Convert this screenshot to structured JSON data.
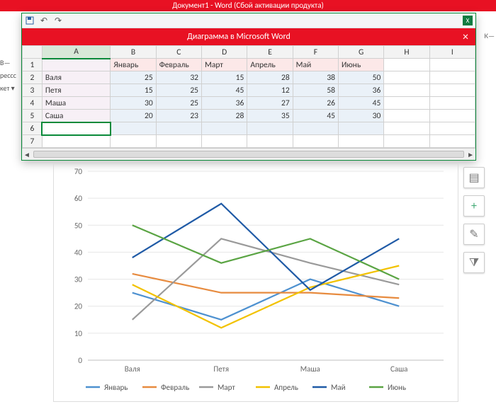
{
  "word_title": "Документ1 - Word (Сбой активации продукта)",
  "excel_title": "Диаграмма в Microsoft Word",
  "left_sliver": [
    "B—",
    "рессс",
    "кет ▾"
  ],
  "right_cut": "К—",
  "col_headers": [
    "A",
    "B",
    "C",
    "D",
    "E",
    "F",
    "G",
    "H",
    "I"
  ],
  "row_numbers": [
    "1",
    "2",
    "3",
    "4",
    "5",
    "6",
    "7"
  ],
  "series_headers": [
    "Январь",
    "Февраль",
    "Март",
    "Апрель",
    "Май",
    "Июнь"
  ],
  "row_labels": [
    "Валя",
    "Петя",
    "Маша",
    "Саша"
  ],
  "grid": [
    [
      25,
      32,
      15,
      28,
      38,
      50
    ],
    [
      15,
      25,
      45,
      12,
      58,
      36
    ],
    [
      30,
      25,
      36,
      27,
      26,
      45
    ],
    [
      20,
      23,
      28,
      35,
      45,
      30
    ]
  ],
  "scroll_markers": {
    "left": "◄",
    "right": "►"
  },
  "side_buttons": [
    {
      "name": "chart-layout-icon",
      "glyph": "▤"
    },
    {
      "name": "chart-element-add-icon",
      "glyph": "+"
    },
    {
      "name": "chart-style-icon",
      "glyph": "✎"
    },
    {
      "name": "chart-filter-icon",
      "glyph": "⧩"
    }
  ],
  "colors": {
    "Январь": "#4e91d0",
    "Февраль": "#e78b3f",
    "Март": "#9a9a9a",
    "Апрель": "#f2c200",
    "Май": "#1f5aa6",
    "Июнь": "#5aa443",
    "grid": "#e6e6e6",
    "axis": "#bfbfbf"
  },
  "chart_data": {
    "type": "line",
    "categories": [
      "Валя",
      "Петя",
      "Маша",
      "Саша"
    ],
    "series": [
      {
        "name": "Январь",
        "values": [
          25,
          15,
          30,
          20
        ]
      },
      {
        "name": "Февраль",
        "values": [
          32,
          25,
          25,
          23
        ]
      },
      {
        "name": "Март",
        "values": [
          15,
          45,
          36,
          28
        ]
      },
      {
        "name": "Апрель",
        "values": [
          28,
          12,
          27,
          35
        ]
      },
      {
        "name": "Май",
        "values": [
          38,
          58,
          26,
          45
        ]
      },
      {
        "name": "Июнь",
        "values": [
          50,
          36,
          45,
          30
        ]
      }
    ],
    "ylim": [
      0,
      70
    ],
    "ystep": 10,
    "xlabel": "",
    "ylabel": "",
    "title": "",
    "grid": true,
    "legend_position": "bottom"
  }
}
